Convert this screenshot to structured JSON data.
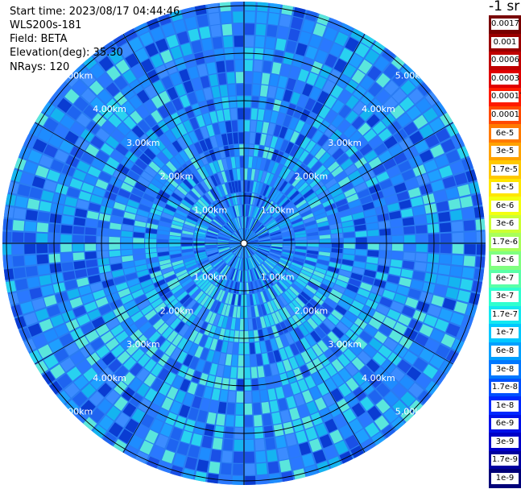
{
  "header": {
    "start_time": "Start time: 2023/08/17 04:44:46",
    "instrument": "WLS200s-181",
    "field": "Field: BETA",
    "elevation": "Elevation(deg): 35.30",
    "nrays": "NRays: 120"
  },
  "units": "-1 sr",
  "ring_labels": [
    "1.00km",
    "2.00km",
    "3.00km",
    "4.00km",
    "5.00km"
  ],
  "colorbar": {
    "labels": [
      "0.0017",
      "0.001",
      "0.0006",
      "0.0003",
      "0.00017",
      "0.0001",
      "6e-5",
      "3e-5",
      "1.7e-5",
      "1e-5",
      "6e-6",
      "3e-6",
      "1.7e-6",
      "1e-6",
      "6e-7",
      "3e-7",
      "1.7e-7",
      "1e-7",
      "6e-8",
      "3e-8",
      "1.7e-8",
      "1e-8",
      "6e-9",
      "3e-9",
      "1.7e-9",
      "1e-9"
    ],
    "colors": [
      "#780000",
      "#9a0000",
      "#c00000",
      "#e00000",
      "#ff1a00",
      "#ff4a00",
      "#ff7a00",
      "#ffa200",
      "#ffc800",
      "#ffe600",
      "#f4ff10",
      "#ccff33",
      "#a8ff5a",
      "#80ff80",
      "#5affa8",
      "#30ffcf",
      "#14e8f0",
      "#00c8ff",
      "#00a0ff",
      "#0078ff",
      "#0050ff",
      "#0028ff",
      "#0010e8",
      "#0000c8",
      "#0000a0",
      "#000078"
    ]
  }
}
